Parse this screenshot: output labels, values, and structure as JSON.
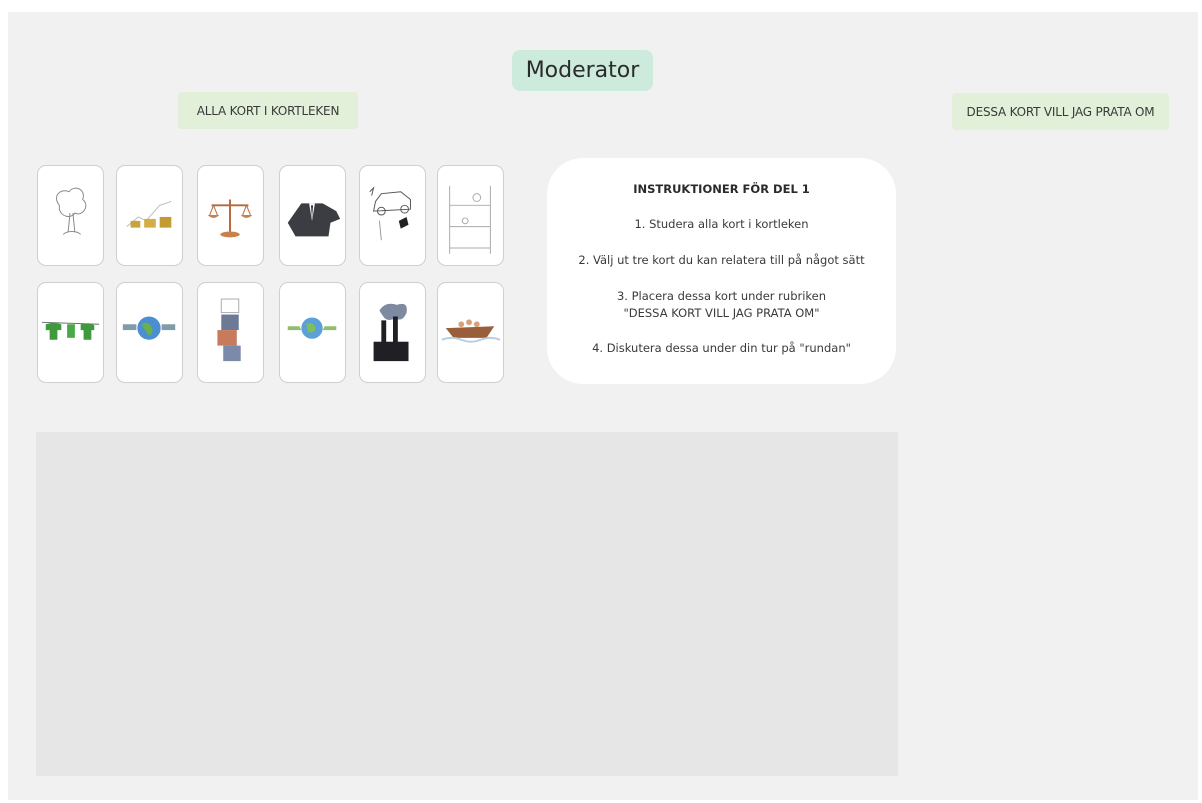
{
  "board": {
    "moderator_label": "Moderator",
    "all_cards_label": "ALLA KORT I KORTLEKEN",
    "talk_cards_label": "DESSA KORT VILL JAG PRATA OM"
  },
  "cards": [
    {
      "icon": "tree-sketch-icon"
    },
    {
      "icon": "gold-bars-growth-icon"
    },
    {
      "icon": "scales-icon"
    },
    {
      "icon": "businessman-suit-icon"
    },
    {
      "icon": "car-sketch-icon"
    },
    {
      "icon": "ladder-shelf-sketch-icon"
    },
    {
      "icon": "clothesline-shirts-icon"
    },
    {
      "icon": "globe-money-icon"
    },
    {
      "icon": "puzzle-pieces-icon"
    },
    {
      "icon": "globe-hands-icon"
    },
    {
      "icon": "factory-smoke-icon"
    },
    {
      "icon": "boat-people-icon"
    }
  ],
  "instructions": {
    "title": "INSTRUKTIONER FÖR DEL 1",
    "step1": "1. Studera alla kort i kortleken",
    "step2": "2. Välj ut tre kort du kan relatera till på något sätt",
    "step3_line1": "3. Placera dessa kort under rubriken",
    "step3_line2": "\"DESSA KORT VILL JAG PRATA OM\"",
    "step4": "4. Diskutera dessa under din tur på \"rundan\""
  },
  "colors": {
    "moderator_bg": "#cdebdc",
    "label_bg": "#e2efd9",
    "board_bg": "#f1f1f1",
    "dropzone_bg": "#e6e6e6"
  }
}
